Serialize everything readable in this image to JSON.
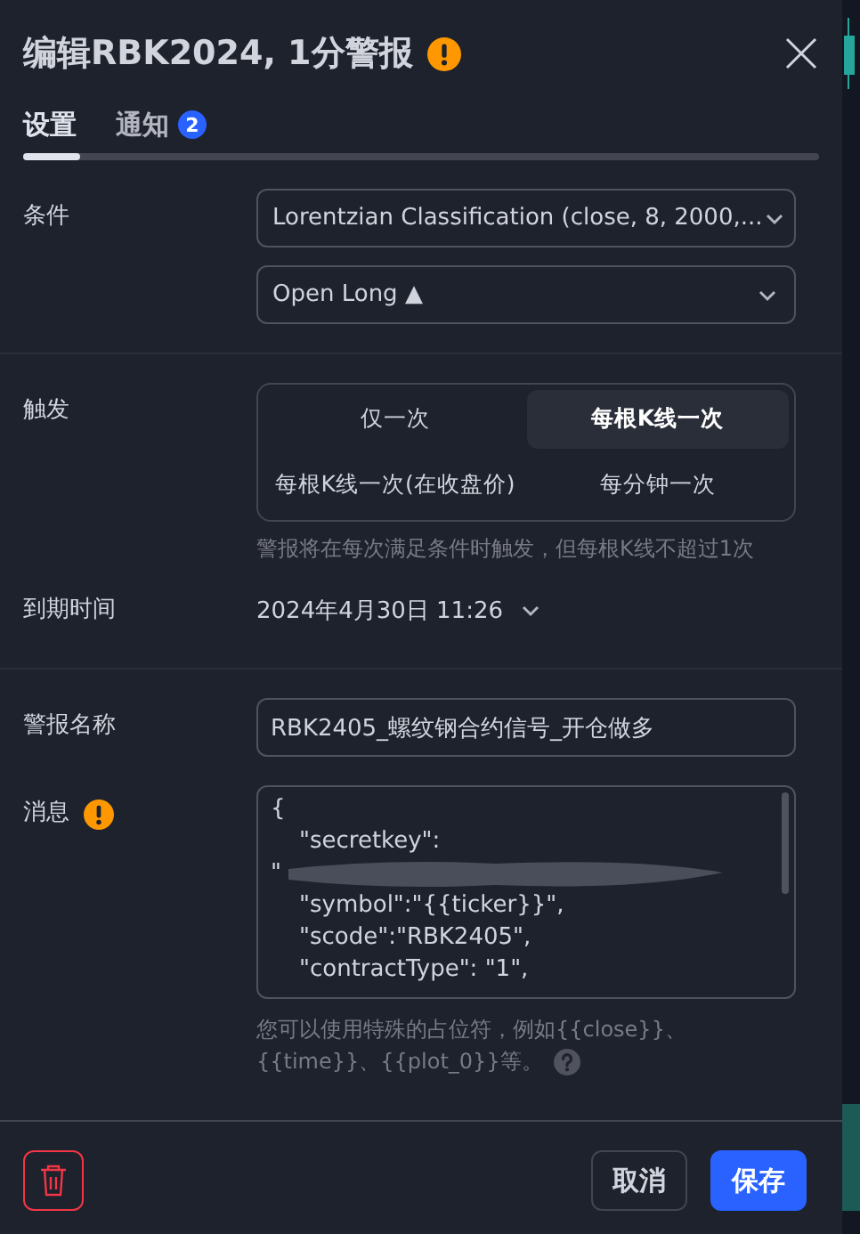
{
  "dialog": {
    "title": "编辑RBK2024, 1分警报",
    "warning": true
  },
  "tabs": [
    {
      "label": "设置",
      "selected": true
    },
    {
      "label": "通知",
      "selected": false,
      "badge": "2"
    }
  ],
  "condition": {
    "label": "条件",
    "selects": [
      "Lorentzian Classification (close, 8, 2000,...",
      "Open Long ▲"
    ]
  },
  "trigger": {
    "label": "触发",
    "options": [
      {
        "label": "仅一次",
        "selected": false
      },
      {
        "label": "每根K线一次",
        "selected": true
      },
      {
        "label": "每根K线一次(在收盘价)",
        "selected": false
      },
      {
        "label": "每分钟一次",
        "selected": false
      }
    ],
    "hint": "警报将在每次满足条件时触发，但每根K线不超过1次"
  },
  "expiration": {
    "label": "到期时间",
    "value": "2024年4月30日 11:26"
  },
  "alert_name": {
    "label": "警报名称",
    "value": "RBK2405_螺纹钢合约信号_开仓做多"
  },
  "message": {
    "label": "消息",
    "warning": true,
    "lines": [
      {
        "text": "{",
        "kind": "plain"
      },
      {
        "text": "\"secretkey\":",
        "kind": "indented"
      },
      {
        "text": "\"",
        "kind": "redacted"
      },
      {
        "text": "\"symbol\":\"{{ticker}}\",",
        "kind": "indented"
      },
      {
        "text": "\"scode\":\"RBK2405\",",
        "kind": "indented"
      },
      {
        "text": "\"contractType\": \"1\",",
        "kind": "indented"
      }
    ],
    "hint": "您可以使用特殊的占位符，例如{{close}}、{{time}}、{{plot_0}}等。"
  },
  "buttons": {
    "cancel": "取消",
    "save": "保存"
  }
}
